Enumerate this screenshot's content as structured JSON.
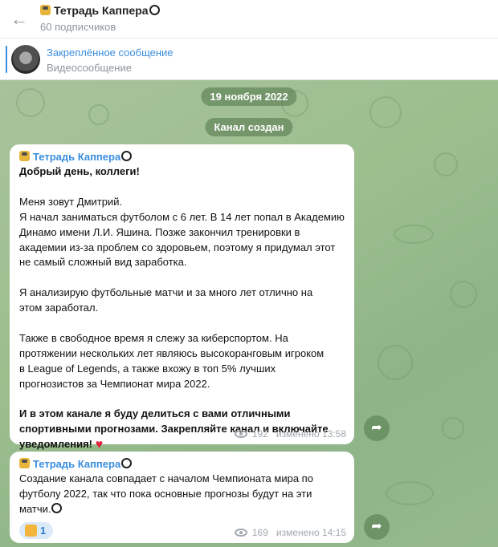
{
  "header": {
    "title": "Тетрадь Каппера",
    "subtitle": "60 подписчиков",
    "back_icon": "arrow-left-icon"
  },
  "pinned": {
    "title": "Закреплённое сообщение",
    "subtitle": "Видеосообщение"
  },
  "chat": {
    "date_label": "19 ноября 2022",
    "service_label": "Канал создан",
    "messages": [
      {
        "sender": "Тетрадь Каппера",
        "lines": [
          {
            "text": "Добрый день, коллеги!",
            "bold": true
          },
          {
            "text": ""
          },
          {
            "text": "Меня зовут Дмитрий."
          },
          {
            "text": "Я начал заниматься футболом с 6 лет. В 14 лет попал в Академию"
          },
          {
            "text": "Динамо имени Л.И. Яшина. Позже закончил тренировки в"
          },
          {
            "text": "академии из-за проблем со здоровьем, поэтому я придумал этот"
          },
          {
            "text": "не самый сложный вид заработка."
          },
          {
            "text": ""
          },
          {
            "text": "Я анализирую футбольные матчи и за много лет отлично на"
          },
          {
            "text": "этом заработал."
          },
          {
            "text": ""
          },
          {
            "text": "Также в свободное время я слежу за киберспортом. На"
          },
          {
            "text": "протяжении нескольких лет являюсь высокоранговым игроком"
          },
          {
            "text": "в League of Legends, а также вхожу в топ 5% лучших"
          },
          {
            "text": "прогнозистов за Чемпионат мира 2022."
          },
          {
            "text": ""
          },
          {
            "text": "И в этом канале я буду делиться с вами отличными",
            "bold": true
          },
          {
            "text": "спортивными прогнозами. Закрепляйте канал и включайте",
            "bold": true
          },
          {
            "text": "уведомления!",
            "bold": true
          }
        ],
        "views": "192",
        "edited_label": "изменено 13:58"
      },
      {
        "sender": "Тетрадь Каппера",
        "lines": [
          {
            "text": "Создание канала совпадает с началом Чемпионата мира по"
          },
          {
            "text": "футболу 2022, так что пока основные прогнозы будут на эти"
          },
          {
            "text": "матчи."
          }
        ],
        "reaction_count": "1",
        "views": "169",
        "edited_label": "изменено 14:15"
      }
    ]
  }
}
